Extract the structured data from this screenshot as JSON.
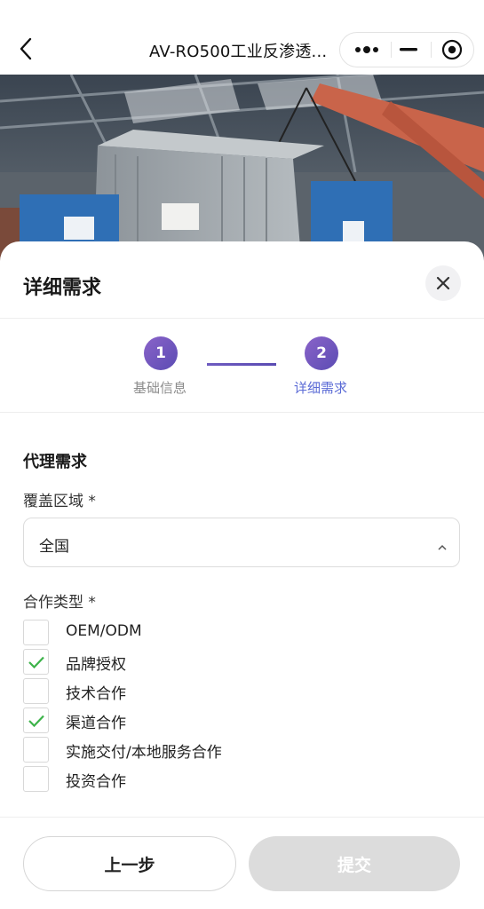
{
  "navbar": {
    "title": "AV-RO500工业反渗透...",
    "icons": [
      "back-arrow-icon",
      "more-dots-icon",
      "minimize-icon",
      "target-circle-icon"
    ]
  },
  "sheet": {
    "title": "详细需求",
    "close_icon": "close-icon",
    "steps": [
      {
        "number": "1",
        "label": "基础信息",
        "state": "completed"
      },
      {
        "number": "2",
        "label": "详细需求",
        "state": "active"
      }
    ],
    "section_title": "代理需求",
    "coverage": {
      "label": "覆盖区域 *",
      "value": "全国"
    },
    "cooperation": {
      "label": "合作类型 *",
      "options": [
        {
          "label": "OEM/ODM",
          "checked": false
        },
        {
          "label": "品牌授权",
          "checked": true
        },
        {
          "label": "技术合作",
          "checked": false
        },
        {
          "label": "渠道合作",
          "checked": true
        },
        {
          "label": "实施交付/本地服务合作",
          "checked": false
        },
        {
          "label": "投资合作",
          "checked": false
        }
      ]
    }
  },
  "footer": {
    "prev_label": "上一步",
    "submit_label": "提交"
  },
  "colors": {
    "accent": "#5e4fb5",
    "step_active_text": "#5b6bd6",
    "step_done_text": "#8c8c8c",
    "check": "#3db34a",
    "disabled_button": "#dcdcdc"
  }
}
